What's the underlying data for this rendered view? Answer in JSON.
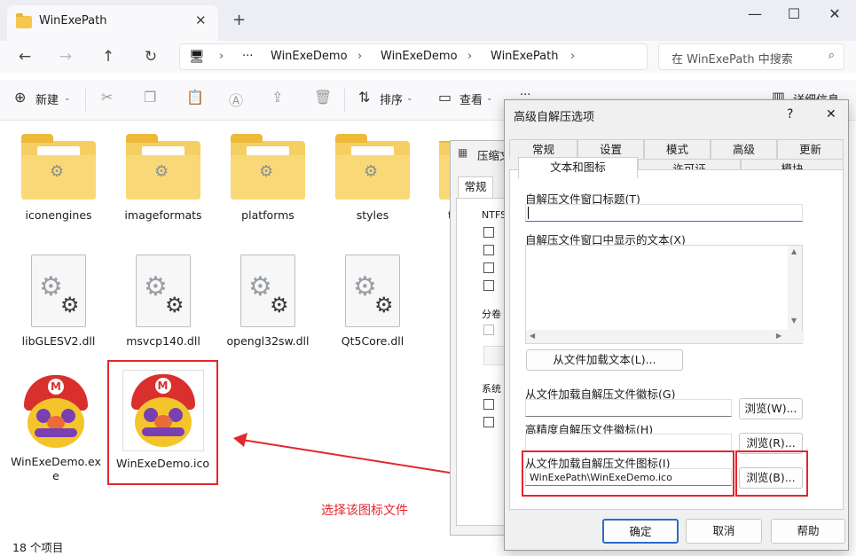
{
  "window": {
    "tab_title": "WinExePath",
    "close_tab": "✕",
    "new_tab": "+"
  },
  "window_controls": {
    "minimize": "—",
    "maximize": "☐",
    "close": "✕"
  },
  "nav": {
    "back": "←",
    "forward": "→",
    "up": "↑",
    "refresh": "↻"
  },
  "breadcrumb": {
    "more": "···",
    "sep": "›",
    "items": [
      "WinExeDemo",
      "WinExeDemo",
      "WinExePath"
    ]
  },
  "search": {
    "placeholder": "在 WinExePath 中搜索"
  },
  "toolbar": {
    "new_label": "新建",
    "sort_label": "排序",
    "view_label": "查看",
    "more": "···",
    "details_label": "详细信息"
  },
  "files": [
    {
      "name": "iconengines",
      "type": "folder"
    },
    {
      "name": "imageformats",
      "type": "folder"
    },
    {
      "name": "platforms",
      "type": "folder"
    },
    {
      "name": "styles",
      "type": "folder"
    },
    {
      "name": "t",
      "type": "folder"
    },
    {
      "name": "libGLESV2.dll",
      "type": "dll"
    },
    {
      "name": "msvcp140.dll",
      "type": "dll"
    },
    {
      "name": "opengl32sw.dll",
      "type": "dll"
    },
    {
      "name": "Qt5Core.dll",
      "type": "dll"
    },
    {
      "name": "WinExeDemo.exe",
      "type": "exe"
    },
    {
      "name": "WinExeDemo.ico",
      "type": "ico"
    }
  ],
  "status": {
    "item_count": "18 个项目"
  },
  "bg_dialog": {
    "title": "压缩文",
    "tab": "常规",
    "ntfs": "NTFS",
    "vol": "分卷",
    "sys": "系统"
  },
  "dialog": {
    "title": "高级自解压选项",
    "help": "?",
    "close": "✕",
    "tabs_row1": [
      "常规",
      "设置",
      "模式",
      "高级",
      "更新"
    ],
    "tabs_row2": [
      "文本和图标",
      "许可证",
      "模块"
    ],
    "window_title_label": "自解压文件窗口标题(T)",
    "window_title_value": "",
    "display_text_label": "自解压文件窗口中显示的文本(X)",
    "load_text_button": "从文件加载文本(L)...",
    "load_icon_label": "从文件加载自解压文件徽标(G)",
    "browse_w": "浏览(W)...",
    "hires_label": "高精度自解压文件徽标(H)",
    "browse_r": "浏览(R)...",
    "icon_label": "从文件加载自解压文件图标(I)",
    "icon_value": "WinExePath\\WinExeDemo.ico",
    "browse_b": "浏览(B)...",
    "ok": "确定",
    "cancel": "取消",
    "help_button": "帮助"
  },
  "annotation": {
    "text": "选择该图标文件"
  }
}
